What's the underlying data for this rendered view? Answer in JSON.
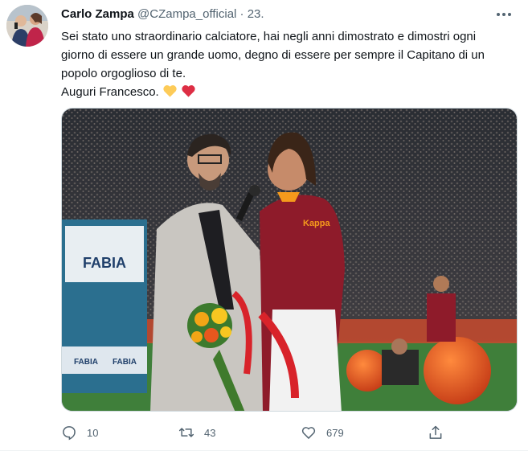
{
  "tweet": {
    "author_name": "Carlo Zampa",
    "handle": "@CZampa_official",
    "separator": "·",
    "time": "23.",
    "text_line": "Sei stato uno straordinario calciatore, hai negli anni dimostrato e dimostri ogni giorno di essere un grande uomo, degno di essere per sempre il Capitano di un popolo orgoglioso di te.",
    "text_line2": "Auguri Francesco.",
    "emojis": [
      "yellow-heart-icon",
      "red-heart-icon"
    ],
    "media": {
      "banner_left": "FABIA",
      "banner_small": [
        "FABIA",
        "FABIA"
      ],
      "shirt_brand": "Kappa"
    }
  },
  "actions": {
    "replies": "10",
    "retweets": "43",
    "likes": "679"
  },
  "colors": {
    "text": "#0f1419",
    "secondary": "#536471",
    "roma_red": "#8e1b2a",
    "roma_orange": "#f59a1c"
  }
}
